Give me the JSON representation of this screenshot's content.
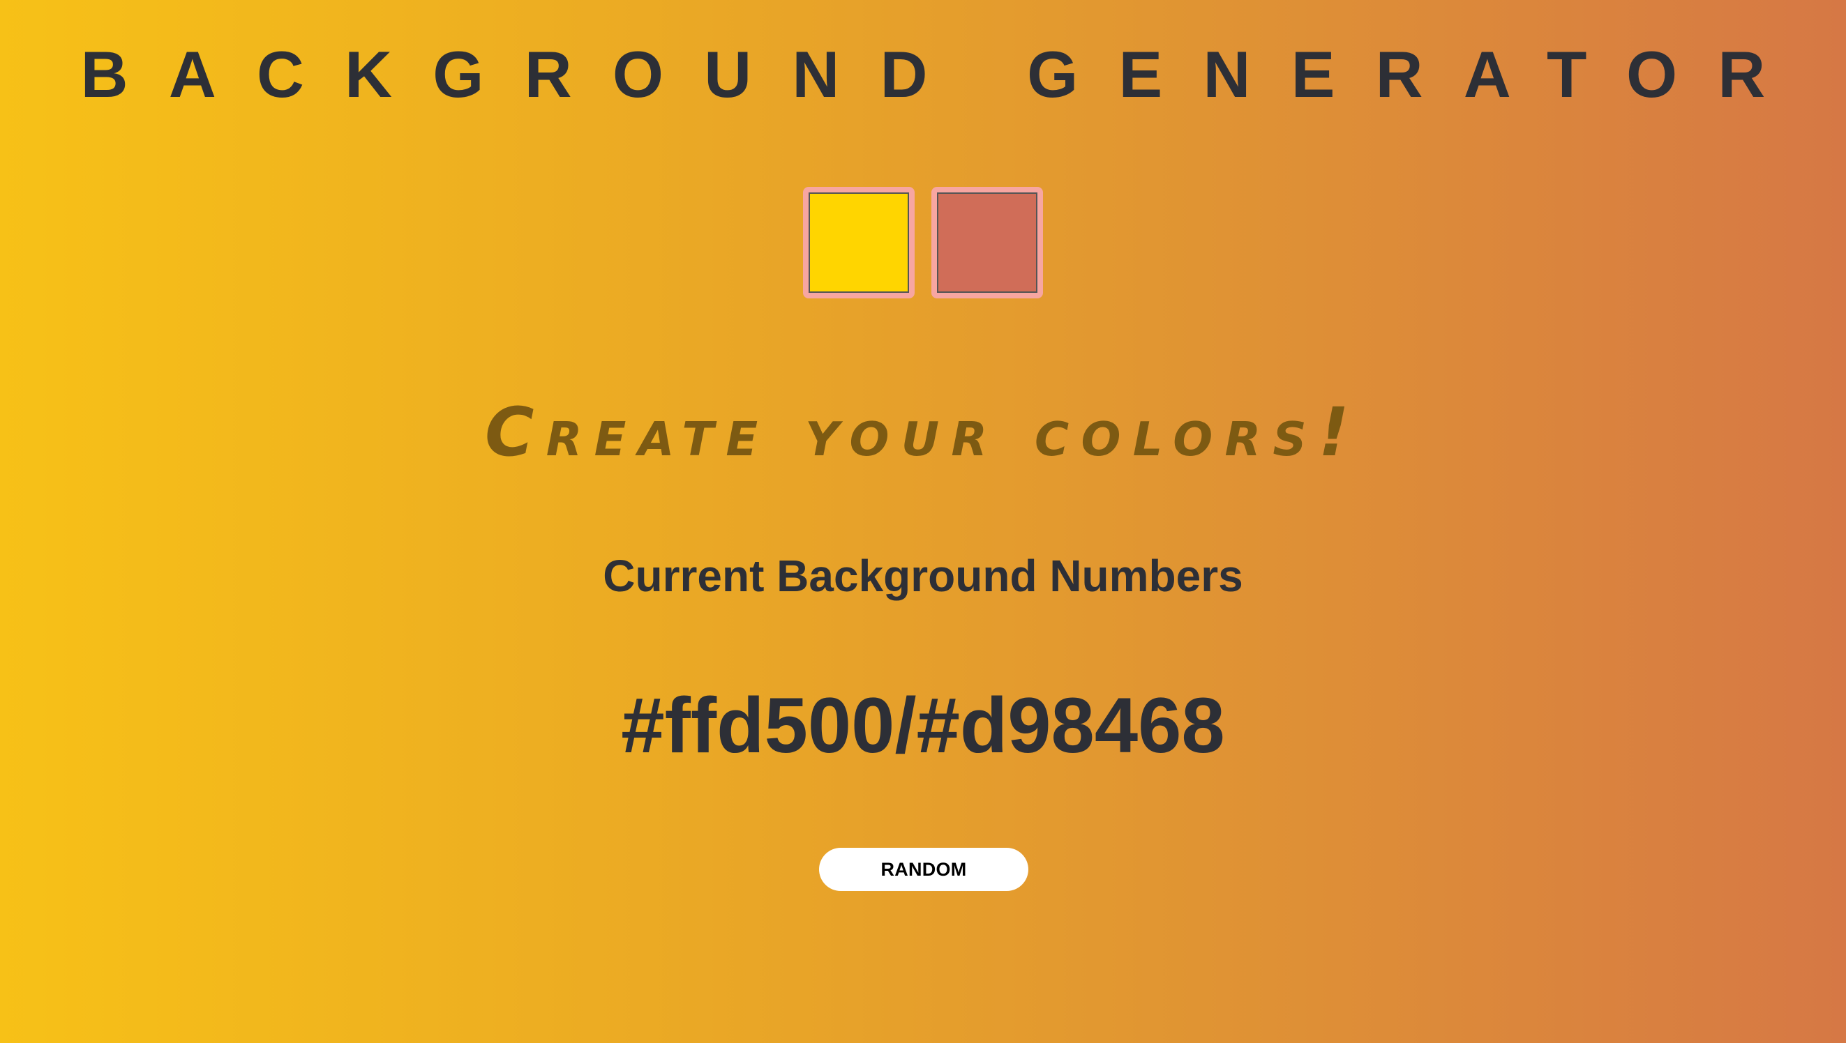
{
  "header": {
    "title": "BACKGROUND GENERATOR"
  },
  "pickers": {
    "color1": "#ffd500",
    "color2": "#d98468"
  },
  "main": {
    "tagline": "Create your colors!",
    "subheading": "Current Background Numbers",
    "current_values": "#ffd500/#d98468",
    "random_label": "RANDOM"
  },
  "theme": {
    "gradient_start": "#f7c117",
    "gradient_end": "#d67845",
    "text_color": "#2d2f36",
    "picker_border": "#f7a6a1"
  }
}
